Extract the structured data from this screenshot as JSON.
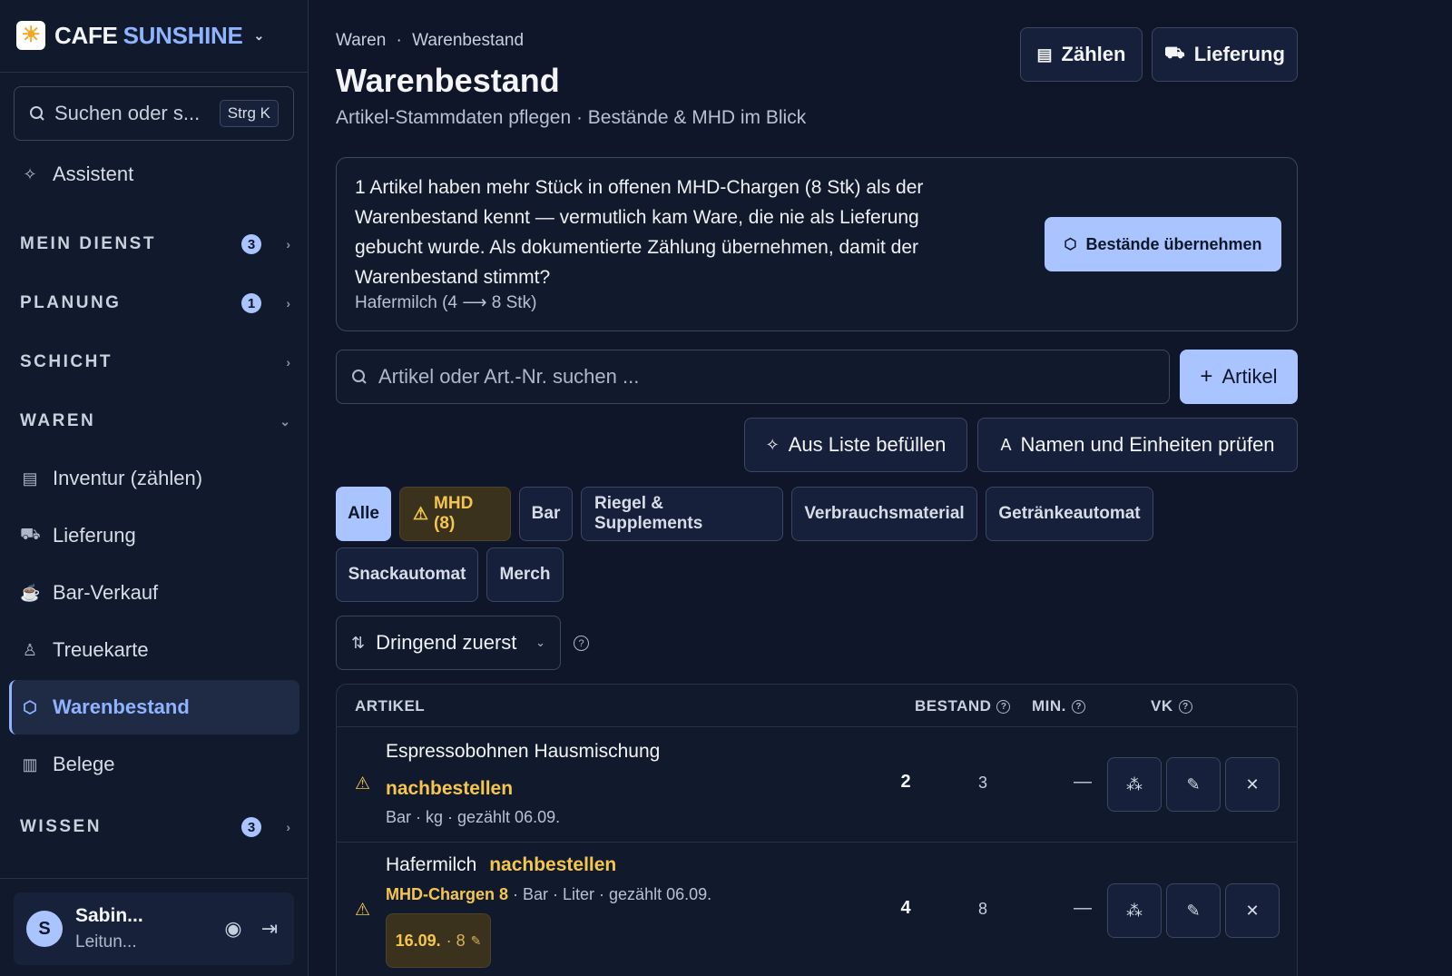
{
  "brand": {
    "name_part1": "CAFE",
    "name_part2": "SUNSHINE",
    "logo_icon": "sun-icon"
  },
  "sidebar": {
    "search_placeholder": "Suchen oder s...",
    "search_shortcut": "Strg K",
    "assistant_label": "Assistent",
    "sections": [
      {
        "label": "MEIN DIENST",
        "badge": "3"
      },
      {
        "label": "PLANUNG",
        "badge": "1"
      },
      {
        "label": "SCHICHT",
        "badge": ""
      },
      {
        "label": "WAREN",
        "badge": ""
      },
      {
        "label": "WISSEN",
        "badge": "3"
      }
    ],
    "waren_items": [
      {
        "label": "Inventur (zählen)",
        "icon": "clipboard-icon"
      },
      {
        "label": "Lieferung",
        "icon": "truck-icon"
      },
      {
        "label": "Bar-Verkauf",
        "icon": "cup-icon"
      },
      {
        "label": "Treuekarte",
        "icon": "stamp-icon"
      },
      {
        "label": "Warenbestand",
        "icon": "package-icon",
        "active": true
      },
      {
        "label": "Belege",
        "icon": "receipt-icon"
      }
    ],
    "user": {
      "initial": "S",
      "name": "Sabin...",
      "role": "Leitun..."
    }
  },
  "header": {
    "breadcrumb_parent": "Waren",
    "breadcrumb_sep": "·",
    "breadcrumb_current": "Warenbestand",
    "title": "Warenbestand",
    "subtitle": "Artikel-Stammdaten pflegen · Bestände & MHD im Blick",
    "count_button": "Zählen",
    "delivery_button": "Lieferung"
  },
  "notice": {
    "text": "1 Artikel haben mehr Stück in offenen MHD-Chargen (8 Stk) als der Warenbestand kennt — vermutlich kam Ware, die nie als Lieferung gebucht wurde. Als dokumentierte Zählung übernehmen, damit der Warenbestand stimmt?",
    "detail": "Hafermilch (4 ⟶ 8 Stk)",
    "action": "Bestände übernehmen"
  },
  "toolbar": {
    "search_placeholder": "Artikel oder Art.-Nr. suchen ...",
    "add_button": "Artikel",
    "fill_from_list": "Aus Liste befüllen",
    "check_names": "Namen und Einheiten prüfen"
  },
  "filters": [
    "Alle",
    "MHD (8)",
    "Bar",
    "Riegel & Supplements",
    "Verbrauchsmaterial",
    "Getränkeautomat",
    "Snackautomat",
    "Merch"
  ],
  "sort": {
    "label": "Dringend zuerst"
  },
  "table": {
    "columns": {
      "article": "ARTIKEL",
      "stock": "BESTAND",
      "min": "MIN.",
      "vk": "VK"
    },
    "rows": [
      {
        "name": "Espressobohnen Hausmischung",
        "status": "nachbestellen",
        "meta": "Bar · kg · gezählt 06.09.",
        "stock": "2",
        "min": "3",
        "vk": "—"
      },
      {
        "name": "Hafermilch",
        "status": "nachbestellen",
        "mhd": "MHD-Chargen 8",
        "meta": " · Bar · Liter · gezählt 06.09.",
        "stock": "4",
        "min": "8",
        "vk": "—",
        "lot_date": "16.09.",
        "lot_count": "· 8"
      }
    ]
  },
  "colors": {
    "accent": "#a9c4ff",
    "warning": "#f5c64f",
    "background": "#0f1629"
  }
}
